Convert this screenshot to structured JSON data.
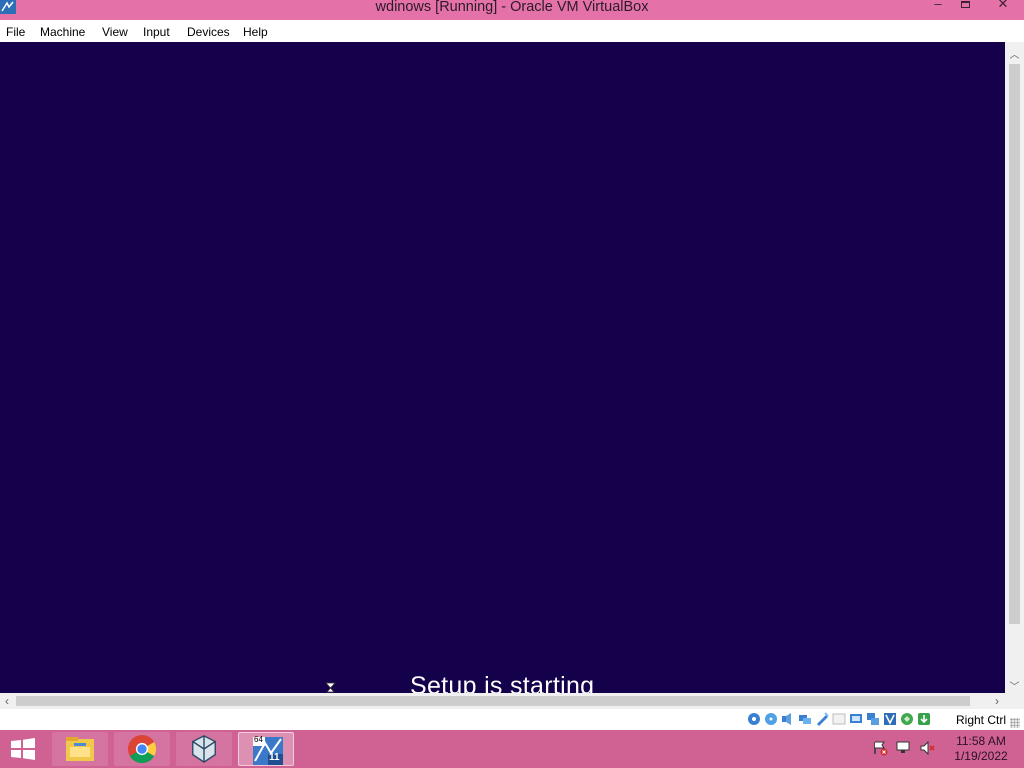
{
  "window": {
    "title": "wdinows [Running] - Oracle VM VirtualBox",
    "controls": {
      "minimize": "–",
      "close": "✕"
    }
  },
  "menu": {
    "items": [
      "File",
      "Machine",
      "View",
      "Input",
      "Devices",
      "Help"
    ]
  },
  "vm": {
    "background": "#14004b",
    "setup_text": "Setup is starting"
  },
  "statusbar": {
    "device_icons": [
      "hard-disk-icon",
      "optical-drive-icon",
      "audio-icon",
      "network-icon",
      "usb-icon",
      "shared-folders-icon",
      "display-icon",
      "video-capture-icon",
      "virtualization-icon",
      "guest-additions-icon",
      "mouse-integration-icon"
    ],
    "host_key": "Right Ctrl"
  },
  "taskbar": {
    "apps": [
      "file-explorer-icon",
      "chrome-icon",
      "virtualbox-icon",
      "virtualbox-vm-icon"
    ],
    "active_app": "virtualbox-vm-icon",
    "vm_badge_top": "64",
    "vm_badge_bottom": "11",
    "tray": [
      "action-center-icon",
      "network-tray-icon",
      "volume-muted-icon"
    ],
    "time": "11:58 AM",
    "date": "1/19/2022"
  },
  "colors": {
    "titlebar": "#e472a8",
    "taskbar": "#d06193",
    "vm_background": "#14004b"
  }
}
